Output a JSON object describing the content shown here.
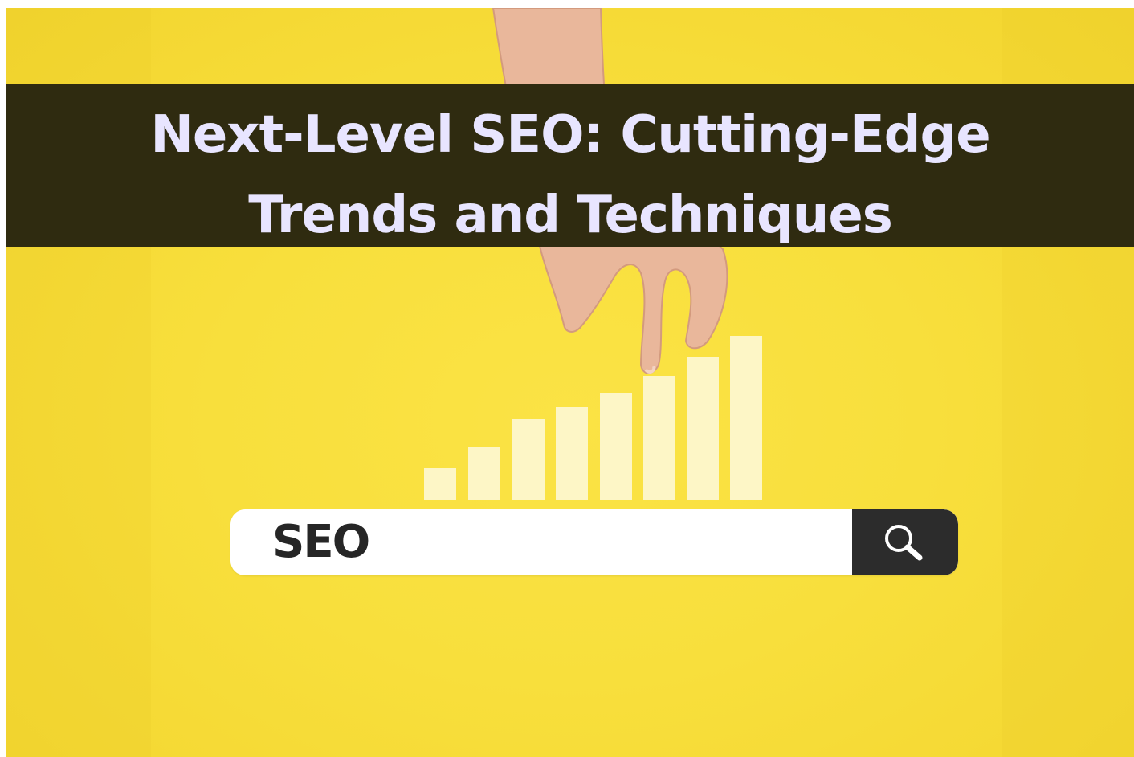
{
  "banner": {
    "title_line1": "Next-Level SEO: Cutting-Edge",
    "title_line2": "Trends and Techniques"
  },
  "search": {
    "query": "SEO",
    "button_icon": "search-icon"
  },
  "colors": {
    "background": "#f8df3c",
    "title_band": "#2f2b10",
    "title_text": "#e8e5ff",
    "bars": "#fdf6c6",
    "search_button": "#2c2c2c"
  },
  "icons": [
    "search-icon"
  ]
}
